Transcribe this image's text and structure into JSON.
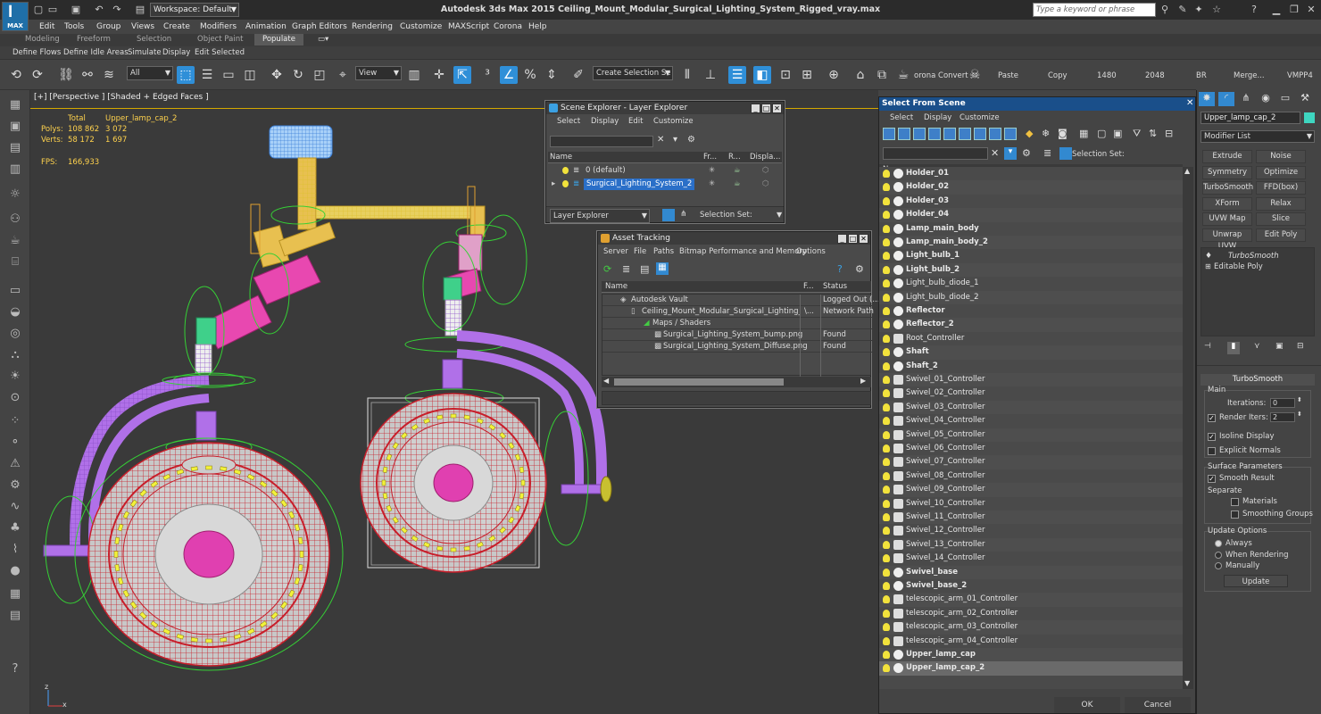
{
  "title_bar": {
    "app_logo": "MAX",
    "workspace": "Workspace: Default",
    "title": "Autodesk 3ds Max  2015      Ceiling_Mount_Modular_Surgical_Lighting_System_Rigged_vray.max",
    "search_placeholder": "Type a keyword or phrase"
  },
  "menu": [
    "Edit",
    "Tools",
    "Group",
    "Views",
    "Create",
    "Modifiers",
    "Animation",
    "Graph Editors",
    "Rendering",
    "Customize",
    "MAXScript",
    "Corona",
    "Help"
  ],
  "ribbon_tabs": [
    "Modeling",
    "Freeform",
    "Selection",
    "Object Paint",
    "Populate"
  ],
  "ribbon_sub": [
    "Define Flows",
    "Define Idle Areas",
    "Simulate",
    "Display",
    "Edit Selected"
  ],
  "toolbar": {
    "filter": "All",
    "coord": "View",
    "selection_set": "Create Selection Se",
    "corona_convert": "orona Convert",
    "paste": "Paste",
    "copy": "Copy",
    "w": "1480",
    "h": "2048",
    "br": "BR",
    "merge": "Merge...",
    "vmpp": "VMPP4"
  },
  "viewport": {
    "label": "[+] [Perspective ] [Shaded + Edged Faces ]",
    "stats": {
      "total": "Total",
      "selected_name": "Upper_lamp_cap_2",
      "polys_label": "Polys:",
      "polys_total": "108 862",
      "polys_sel": "3 072",
      "verts_label": "Verts:",
      "verts_total": "58 172",
      "verts_sel": "1 697",
      "fps_label": "FPS:",
      "fps": "166,933"
    },
    "axis_z": "z",
    "axis_x": "x"
  },
  "scene_explorer": {
    "title": "Scene Explorer - Layer Explorer",
    "menu": [
      "Select",
      "Display",
      "Edit",
      "Customize"
    ],
    "columns": [
      "Name",
      "Fr...",
      "R...",
      "Displa..."
    ],
    "rows": [
      "0 (default)",
      "Surgical_Lighting_System_2"
    ],
    "footer_mode": "Layer Explorer",
    "footer_sel": "Selection Set:"
  },
  "asset_tracking": {
    "title": "Asset Tracking",
    "menu": [
      "Server",
      "File",
      "Paths",
      "Bitmap Performance and Memory",
      "Options"
    ],
    "columns": [
      "Name",
      "F...",
      "Status"
    ],
    "rows": [
      {
        "name": "Autodesk Vault",
        "f": "",
        "status": "Logged Out (..."
      },
      {
        "name": "Ceiling_Mount_Modular_Surgical_Lighting_Sy...",
        "f": "\\...",
        "status": "Network Path"
      },
      {
        "name": "Maps / Shaders",
        "f": "",
        "status": ""
      },
      {
        "name": "Surgical_Lighting_System_bump.png",
        "f": "",
        "status": "Found"
      },
      {
        "name": "Surgical_Lighting_System_Diffuse.png",
        "f": "",
        "status": "Found"
      }
    ]
  },
  "select_from_scene": {
    "title": "Select From Scene",
    "menu": [
      "Select",
      "Display",
      "Customize"
    ],
    "selection_set": "Selection Set:",
    "column": "Name",
    "objects": [
      {
        "name": "Holder_01",
        "bold": true,
        "helper": false
      },
      {
        "name": "Holder_02",
        "bold": true,
        "helper": false
      },
      {
        "name": "Holder_03",
        "bold": true,
        "helper": false
      },
      {
        "name": "Holder_04",
        "bold": true,
        "helper": false
      },
      {
        "name": "Lamp_main_body",
        "bold": true,
        "helper": false
      },
      {
        "name": "Lamp_main_body_2",
        "bold": true,
        "helper": false
      },
      {
        "name": "Light_bulb_1",
        "bold": true,
        "helper": false
      },
      {
        "name": "Light_bulb_2",
        "bold": true,
        "helper": false
      },
      {
        "name": "Light_bulb_diode_1",
        "bold": false,
        "helper": false
      },
      {
        "name": "Light_bulb_diode_2",
        "bold": false,
        "helper": false
      },
      {
        "name": "Reflector",
        "bold": true,
        "helper": false
      },
      {
        "name": "Reflector_2",
        "bold": true,
        "helper": false
      },
      {
        "name": "Root_Controller",
        "bold": false,
        "helper": true
      },
      {
        "name": "Shaft",
        "bold": true,
        "helper": false
      },
      {
        "name": "Shaft_2",
        "bold": true,
        "helper": false
      },
      {
        "name": "Swivel_01_Controller",
        "bold": false,
        "helper": true
      },
      {
        "name": "Swivel_02_Controller",
        "bold": false,
        "helper": true
      },
      {
        "name": "Swivel_03_Controller",
        "bold": false,
        "helper": true
      },
      {
        "name": "Swivel_04_Controller",
        "bold": false,
        "helper": true
      },
      {
        "name": "Swivel_05_Controller",
        "bold": false,
        "helper": true
      },
      {
        "name": "Swivel_06_Controller",
        "bold": false,
        "helper": true
      },
      {
        "name": "Swivel_07_Controller",
        "bold": false,
        "helper": true
      },
      {
        "name": "Swivel_08_Controller",
        "bold": false,
        "helper": true
      },
      {
        "name": "Swivel_09_Controller",
        "bold": false,
        "helper": true
      },
      {
        "name": "Swivel_10_Controller",
        "bold": false,
        "helper": true
      },
      {
        "name": "Swivel_11_Controller",
        "bold": false,
        "helper": true
      },
      {
        "name": "Swivel_12_Controller",
        "bold": false,
        "helper": true
      },
      {
        "name": "Swivel_13_Controller",
        "bold": false,
        "helper": true
      },
      {
        "name": "Swivel_14_Controller",
        "bold": false,
        "helper": true
      },
      {
        "name": "Swivel_base",
        "bold": true,
        "helper": false
      },
      {
        "name": "Swivel_base_2",
        "bold": true,
        "helper": false
      },
      {
        "name": "telescopic_arm_01_Controller",
        "bold": false,
        "helper": true
      },
      {
        "name": "telescopic_arm_02_Controller",
        "bold": false,
        "helper": true
      },
      {
        "name": "telescopic_arm_03_Controller",
        "bold": false,
        "helper": true
      },
      {
        "name": "telescopic_arm_04_Controller",
        "bold": false,
        "helper": true
      },
      {
        "name": "Upper_lamp_cap",
        "bold": true,
        "helper": false
      },
      {
        "name": "Upper_lamp_cap_2",
        "bold": true,
        "helper": false,
        "selected": true
      }
    ],
    "ok": "OK",
    "cancel": "Cancel"
  },
  "command_panel": {
    "object_name": "Upper_lamp_cap_2",
    "object_color": "#3ed6c0",
    "modifier_list": "Modifier List",
    "modifier_buttons": [
      "Extrude",
      "Noise",
      "Symmetry",
      "Optimize",
      "TurboSmooth",
      "FFD(box)",
      "XForm",
      "Relax",
      "UVW Map",
      "Slice",
      "Unwrap UVW",
      "Edit Poly"
    ],
    "stack": [
      "TurboSmooth",
      "Editable Poly"
    ],
    "turbosmooth": {
      "title": "TurboSmooth",
      "main": "Main",
      "iterations_label": "Iterations:",
      "iterations": "0",
      "render_iters_label": "Render Iters:",
      "render_iters": "2",
      "isoline": "Isoline Display",
      "explicit": "Explicit Normals",
      "surface": "Surface Parameters",
      "smooth_result": "Smooth Result",
      "separate": "Separate",
      "materials": "Materials",
      "smoothing_groups": "Smoothing Groups",
      "update_options": "Update Options",
      "always": "Always",
      "when_rendering": "When Rendering",
      "manually": "Manually",
      "update": "Update"
    }
  },
  "colors": {
    "accent": "#2f8fd8",
    "wire_red": "#c81e2a",
    "wire_purple": "#b070e8",
    "wire_green": "#35d035",
    "wire_yellow": "#e0c030",
    "bulb_yellow": "#f2f23a",
    "magenta": "#e040b0"
  }
}
